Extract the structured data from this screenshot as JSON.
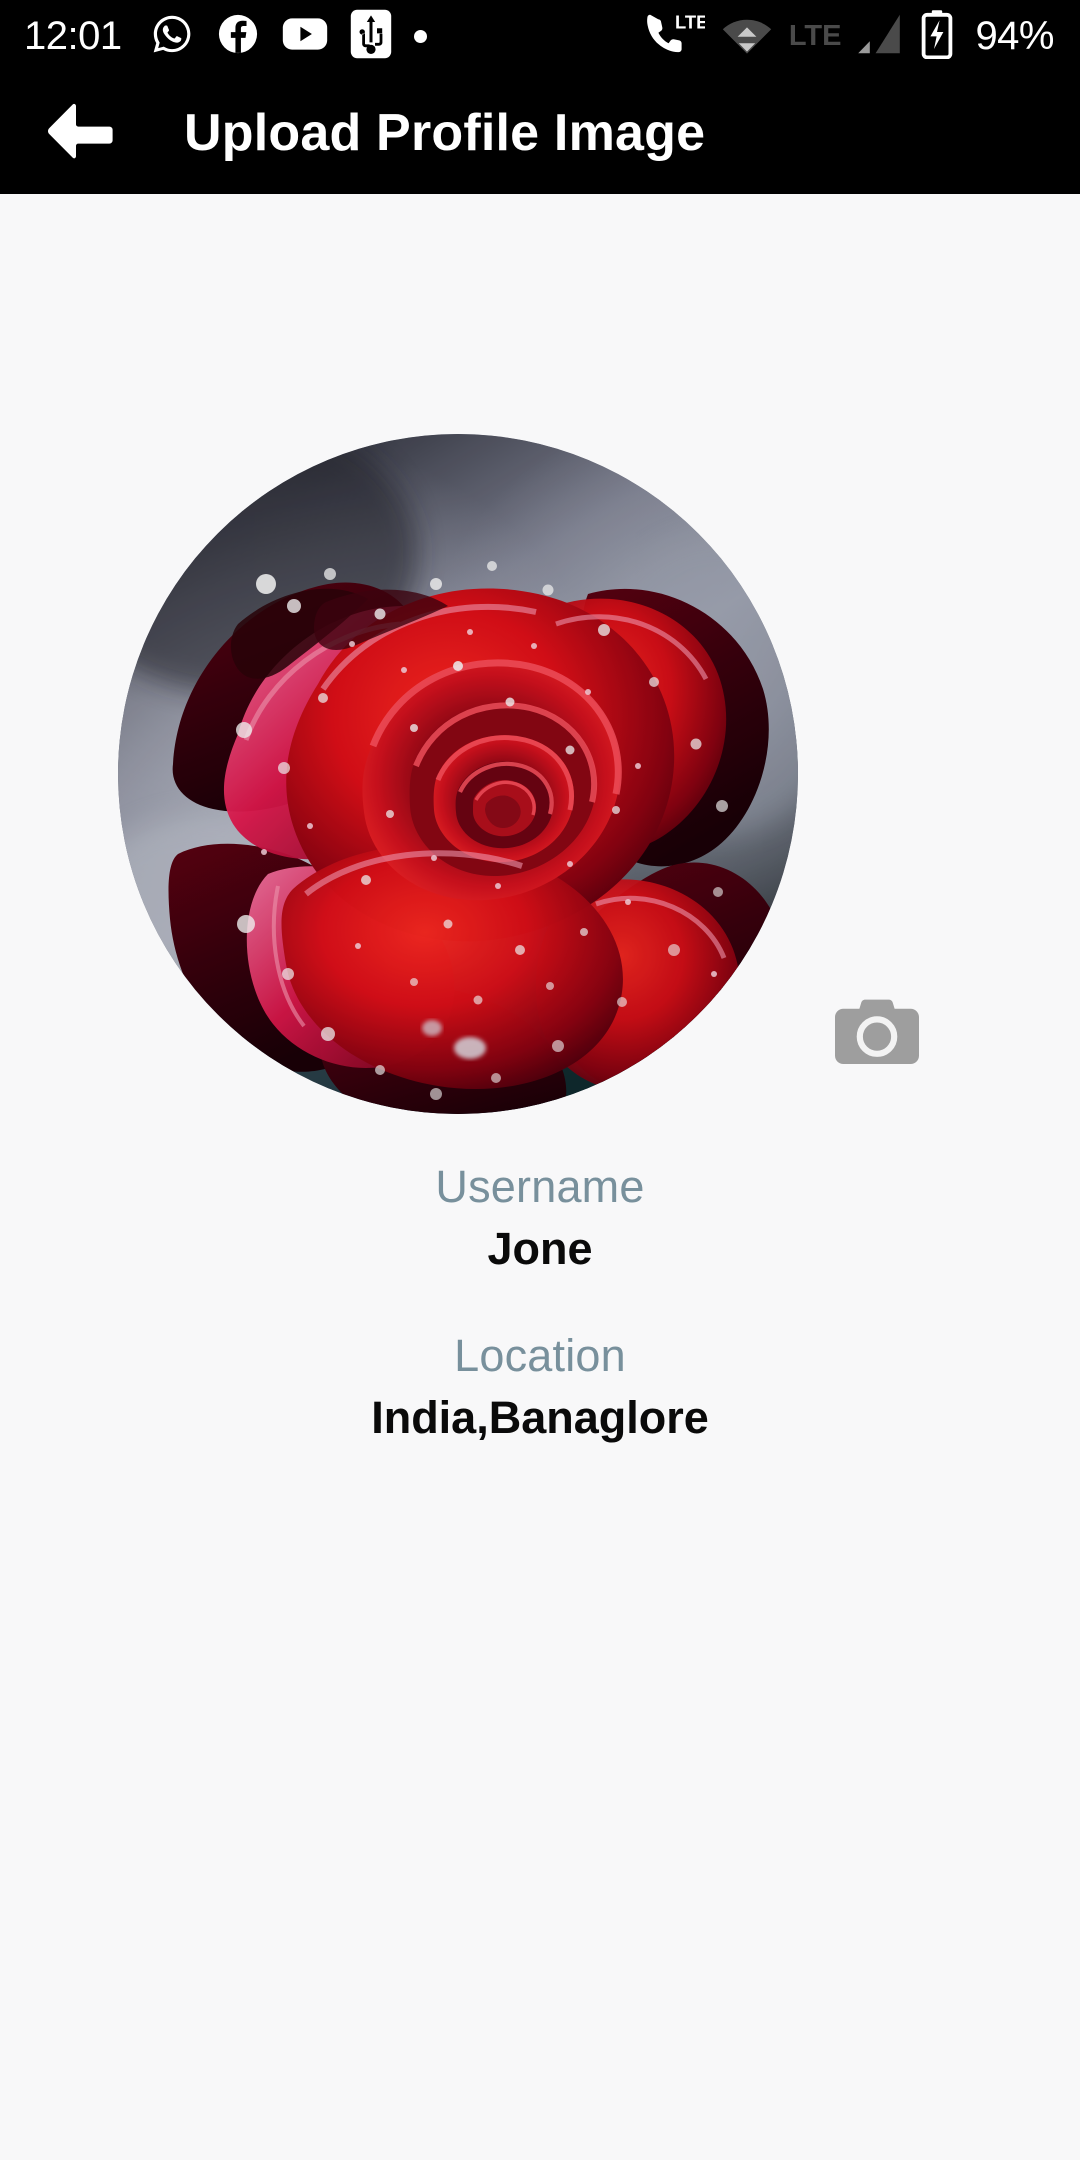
{
  "status_bar": {
    "time": "12:01",
    "battery_percent": "94%",
    "lte_label": "LTE",
    "lte_secondary_label": "LTE",
    "left_icons": [
      "whatsapp-icon",
      "facebook-icon",
      "youtube-icon",
      "usb-icon",
      "dot-indicator-icon"
    ],
    "right_icons": [
      "phone-lte-icon",
      "wifi-icon",
      "lte-text-icon",
      "signal-bars-icon",
      "battery-charging-icon"
    ]
  },
  "app_bar": {
    "back_icon": "back-arrow-icon",
    "title": "Upload Profile Image"
  },
  "profile": {
    "avatar_alt": "red-rose-profile-photo",
    "camera_icon": "camera-icon",
    "fields": [
      {
        "label": "Username",
        "value": "Jone"
      },
      {
        "label": "Location",
        "value": "India,Banaglore"
      }
    ]
  },
  "colors": {
    "app_bar_bg": "#000000",
    "page_bg": "#f8f8f9",
    "label_text": "#78909c",
    "value_text": "#0a0a0a",
    "camera_icon": "#9e9e9e",
    "status_text": "#ffffff",
    "dim_icon": "#4a4a4a"
  }
}
